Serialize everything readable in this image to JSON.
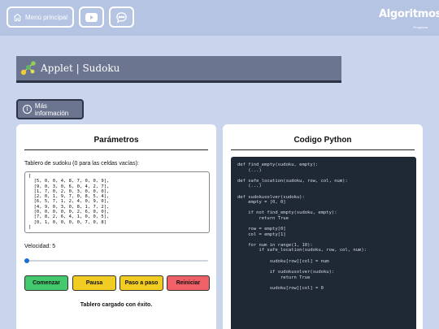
{
  "header": {
    "menu_label": "Menú principal",
    "logo_text": "Algoritmos",
    "logo_sub": "Programa",
    "colors": {
      "bar": "#b5c4e2",
      "page": "#c9d5ec"
    }
  },
  "title": {
    "text": "Applet | Sudoku",
    "icon": "sudoku-network-icon"
  },
  "info_button": {
    "label": "Más información"
  },
  "params": {
    "heading": "Parámetros",
    "board_label": "Tablero de sudoku (0 para las celdas vacías):",
    "board_value": "[\n  [5, 0, 0, 4, 8, 7, 0, 0, 9],\n  [9, 0, 3, 0, 6, 0, 4, 2, 7],\n  [1, 7, 0, 2, 0, 3, 0, 0, 0],\n  [2, 0, 1, 9, 7, 0, 8, 5, 4],\n  [6, 5, 7, 1, 2, 4, 0, 9, 0],\n  [4, 9, 0, 3, 0, 8, 1, 7, 2],\n  [0, 0, 0, 0, 0, 2, 6, 0, 0],\n  [7, 8, 2, 6, 4, 1, 0, 0, 5],\n  [0, 1, 0, 0, 0, 0, 7, 0, 8]\n]",
    "speed_label": "Velocidad: 5",
    "speed_level": 0.0,
    "buttons": {
      "start": "Comenzar",
      "pause": "Pausa",
      "step": "Paso a paso",
      "reset": "Reiniciar"
    },
    "status": "Tablero cargado con éxito."
  },
  "code": {
    "heading": "Codigo Python",
    "lines": [
      "def find_empty(sudoku, empty):",
      "    (...)",
      "",
      "def safe_location(sudoku, row, col, num):",
      "    (...)",
      "",
      "def sudokusolver(sudoku):",
      "    empty = [0, 0]",
      "",
      "    if not find_empty(sudoku, empty):",
      "        return True",
      "",
      "    row = empty[0]",
      "    col = empty[1]",
      "",
      "    for num in range(1, 10):",
      "        if safe_location(sudoku, row, col, num):",
      "",
      "            sudoku[row][col] = num",
      "",
      "            if sudokusolver(sudoku):",
      "                return True",
      "",
      "            sudoku[row][col] = 0"
    ]
  }
}
